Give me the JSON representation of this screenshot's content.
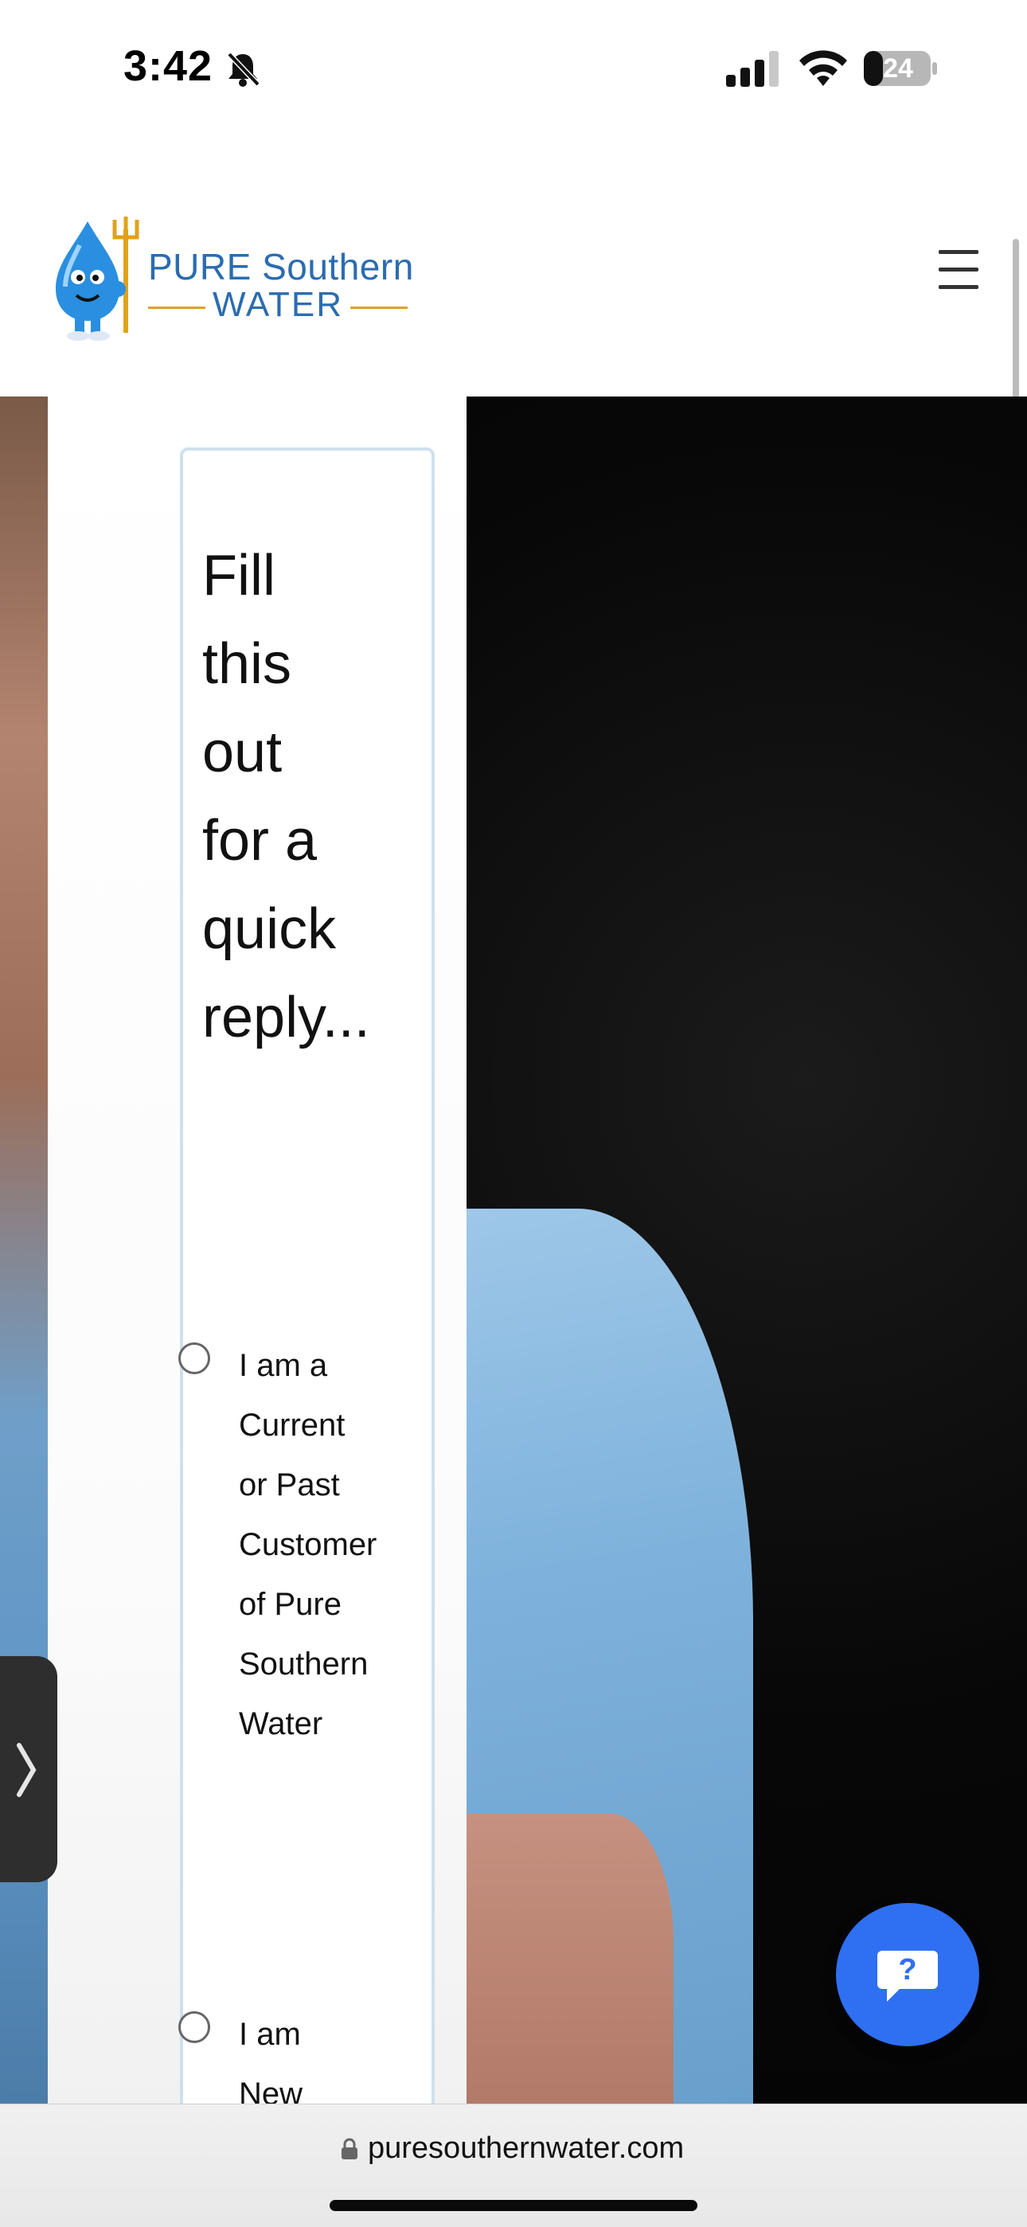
{
  "status_bar": {
    "time": "3:42",
    "battery_level": "24",
    "icons": [
      "bell-slash-icon",
      "cellular-signal-icon",
      "wifi-icon",
      "battery-icon"
    ]
  },
  "header": {
    "logo": {
      "line1": "PURE Southern",
      "line2": "WATER",
      "icon": "water-drop-mascot-icon"
    },
    "menu_icon": "hamburger-menu-icon"
  },
  "form": {
    "heading": "Fill this out for a quick reply...",
    "options": [
      {
        "label": "I am a Current or Past Customer of Pure Southern Water",
        "selected": false
      },
      {
        "label": "I am New",
        "selected": false
      }
    ]
  },
  "side_tab": {
    "icon": "chevron-right-icon"
  },
  "help_button": {
    "icon": "question-chat-icon"
  },
  "browser": {
    "url": "puresouthernwater.com",
    "icon": "lock-icon"
  },
  "colors": {
    "brand_blue": "#2b6cb0",
    "brand_gold": "#e0a21b",
    "help_button": "#2f6ff2",
    "card_border": "#cfe0ec"
  }
}
